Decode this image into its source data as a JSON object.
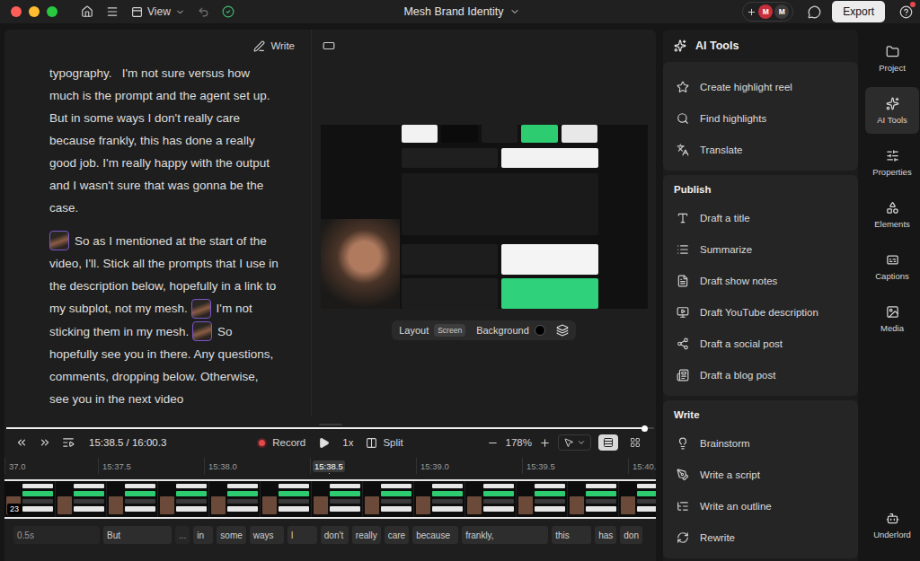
{
  "window": {
    "title": "Mesh Brand Identity"
  },
  "menubar": {
    "view": "View",
    "collaborators": [
      {
        "label": "M",
        "color": "#c62f3b"
      },
      {
        "label": "M",
        "color": "#3b3b3b"
      }
    ],
    "export": "Export",
    "help_notification": true
  },
  "editor": {
    "write": "Write",
    "paragraphs": [
      [
        {
          "kind": "text",
          "text": "typography.   I'm not sure versus how much is the prompt and the agent set up. But in some ways I don't really care because frankly, this has done a really good job. I'm really happy with the output and I wasn't sure that was gonna be the case."
        }
      ],
      [
        {
          "kind": "avatar"
        },
        {
          "kind": "text",
          "text": "So as I mentioned at the start of the video, I'll. Stick all the prompts that I use in the description below, hopefully in a link to my subplot, not my mesh. "
        },
        {
          "kind": "avatar"
        },
        {
          "kind": "text",
          "text": "I'm not sticking them in my mesh. "
        },
        {
          "kind": "avatar"
        },
        {
          "kind": "text",
          "text": "So hopefully see you in there. Any questions, comments, dropping below. Otherwise, see you in the next video"
        }
      ]
    ]
  },
  "preview": {
    "layout": "Layout",
    "layout_value": "Screen",
    "background": "Background",
    "background_color": "#000000"
  },
  "timeline": {
    "time": "15:38.5 / 16:00.3",
    "record": "Record",
    "speed": "1x",
    "split": "Split",
    "zoom": "178%",
    "scroll_level": 0.98,
    "view_modes": [
      {
        "selected": true
      },
      {
        "selected": false
      }
    ],
    "ruler": [
      {
        "label": "37.0",
        "selected": false
      },
      {
        "label": "15:37.5",
        "selected": false
      },
      {
        "label": "15:38.0",
        "selected": false
      },
      {
        "label": "15:38.5",
        "selected": true
      },
      {
        "label": "15:39.0",
        "selected": false
      },
      {
        "label": "15:39.5",
        "selected": false
      },
      {
        "label": "15:40.",
        "selected": false
      }
    ],
    "clip_badge": "23",
    "words": [
      {
        "text": "0.5s",
        "kind": "gap"
      },
      {
        "text": "But",
        "kind": "word"
      },
      {
        "text": "...",
        "kind": "gap"
      },
      {
        "text": "in",
        "kind": "word"
      },
      {
        "text": "some",
        "kind": "word"
      },
      {
        "text": "ways",
        "kind": "word"
      },
      {
        "text": "I",
        "kind": "word"
      },
      {
        "text": "don't",
        "kind": "word"
      },
      {
        "text": "really",
        "kind": "word"
      },
      {
        "text": "care",
        "kind": "word"
      },
      {
        "text": "because",
        "kind": "word"
      },
      {
        "text": "frankly,",
        "kind": "word"
      },
      {
        "text": "this",
        "kind": "word"
      },
      {
        "text": "has",
        "kind": "word"
      },
      {
        "text": "don",
        "kind": "word"
      }
    ]
  },
  "ai_tools": {
    "title": "AI Tools",
    "sections": [
      {
        "items": [
          "Create highlight reel",
          "Find highlights",
          "Translate"
        ]
      },
      {
        "title": "Publish",
        "items": [
          "Draft a title",
          "Summarize",
          "Draft show notes",
          "Draft YouTube description",
          "Draft a social post",
          "Draft a blog post"
        ]
      },
      {
        "title": "Write",
        "items": [
          "Brainstorm",
          "Write a script",
          "Write an outline",
          "Rewrite"
        ]
      }
    ]
  },
  "sidebar": {
    "items": [
      {
        "label": "Project",
        "selected": false
      },
      {
        "label": "AI Tools",
        "selected": true
      },
      {
        "label": "Properties",
        "selected": false
      },
      {
        "label": "Elements",
        "selected": false
      },
      {
        "label": "Captions",
        "selected": false
      },
      {
        "label": "Media",
        "selected": false
      }
    ],
    "footer": {
      "label": "Underlord",
      "selected": false
    }
  }
}
